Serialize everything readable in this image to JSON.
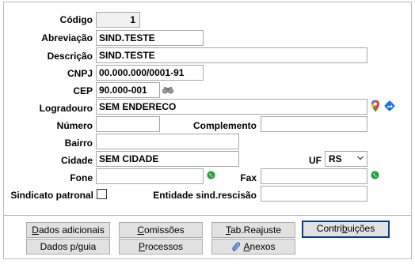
{
  "form": {
    "codigo": {
      "label": "Código",
      "value": "1"
    },
    "abreviacao": {
      "label": "Abreviação",
      "value": "SIND.TESTE"
    },
    "descricao": {
      "label": "Descrição",
      "value": "SIND.TESTE"
    },
    "cnpj": {
      "label": "CNPJ",
      "value": "00.000.000/0001-91"
    },
    "cep": {
      "label": "CEP",
      "value": "90.000-001"
    },
    "logradouro": {
      "label": "Logradouro",
      "value": "SEM ENDERECO"
    },
    "numero": {
      "label": "Número",
      "value": ""
    },
    "complemento": {
      "label": "Complemento",
      "value": ""
    },
    "bairro": {
      "label": "Bairro",
      "value": ""
    },
    "cidade": {
      "label": "Cidade",
      "value": "SEM CIDADE"
    },
    "uf": {
      "label": "UF",
      "value": "RS"
    },
    "fone": {
      "label": "Fone",
      "value": ""
    },
    "fax": {
      "label": "Fax",
      "value": ""
    },
    "sindicato_patronal": {
      "label": "Sindicato patronal",
      "checked": false
    },
    "entidade_rescisao": {
      "label": "Entidade sind.rescisão",
      "value": ""
    }
  },
  "buttons": {
    "dados_adicionais": {
      "pre": "",
      "u": "D",
      "post": "ados adicionais"
    },
    "comissoes": {
      "pre": "",
      "u": "C",
      "post": "omissões"
    },
    "tab_reajuste": {
      "pre": "",
      "u": "T",
      "post": "ab.Reajuste"
    },
    "contribuicoes": {
      "pre": "Contri",
      "u": "b",
      "post": "uições"
    },
    "dados_guia": {
      "pre": "Dados p/",
      "u": "g",
      "post": "uia"
    },
    "processos": {
      "pre": "",
      "u": "P",
      "post": "rocessos"
    },
    "anexos": {
      "pre": "",
      "u": "A",
      "post": "nexos"
    }
  },
  "icons": {
    "cep_search": "binoculars-icon",
    "map_pin": "map-pin-icon",
    "directions": "directions-icon",
    "whatsapp": "whatsapp-icon",
    "clip": "paperclip-icon"
  },
  "colors": {
    "focus_border": "#0a3a8c",
    "whatsapp": "#25a244",
    "directions": "#1a73e8"
  }
}
